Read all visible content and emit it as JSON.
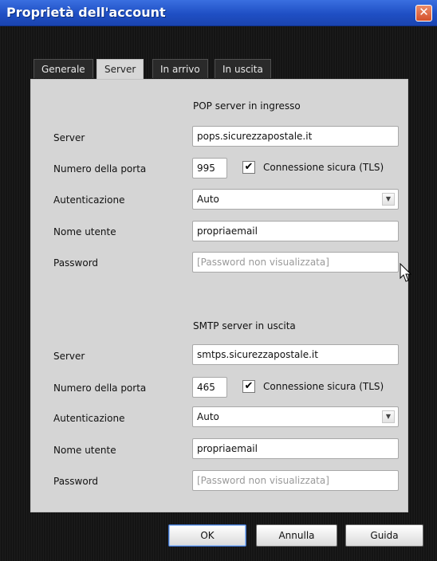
{
  "window": {
    "title": "Proprietà dell'account",
    "close_symbol": "✕"
  },
  "tabs": [
    {
      "label": "Generale",
      "active": false
    },
    {
      "label": "Server",
      "active": true
    },
    {
      "label": "In arrivo",
      "active": false
    },
    {
      "label": "In uscita",
      "active": false
    }
  ],
  "incoming": {
    "section_title": "POP server in ingresso",
    "server_label": "Server",
    "server_value": "pops.sicurezzapostale.it",
    "port_label": "Numero della porta",
    "port_value": "995",
    "secure_checked": true,
    "secure_label": "Connessione sicura (TLS)",
    "auth_label": "Autenticazione",
    "auth_value": "Auto",
    "username_label": "Nome utente",
    "username_value": "propriaemail",
    "password_label": "Password",
    "password_placeholder": "[Password non visualizzata]"
  },
  "outgoing": {
    "section_title": "SMTP server in uscita",
    "server_label": "Server",
    "server_value": "smtps.sicurezzapostale.it",
    "port_label": "Numero della porta",
    "port_value": "465",
    "secure_checked": true,
    "secure_label": "Connessione sicura (TLS)",
    "auth_label": "Autenticazione",
    "auth_value": "Auto",
    "username_label": "Nome utente",
    "username_value": "propriaemail",
    "password_label": "Password",
    "password_placeholder": "[Password non visualizzata]"
  },
  "buttons": {
    "ok": "OK",
    "cancel": "Annulla",
    "help": "Guida"
  },
  "icons": {
    "check": "✔",
    "dropdown": "▼"
  },
  "colors": {
    "titlebar": "#245edc",
    "close": "#d4502a",
    "panel": "#d5d5d5"
  }
}
